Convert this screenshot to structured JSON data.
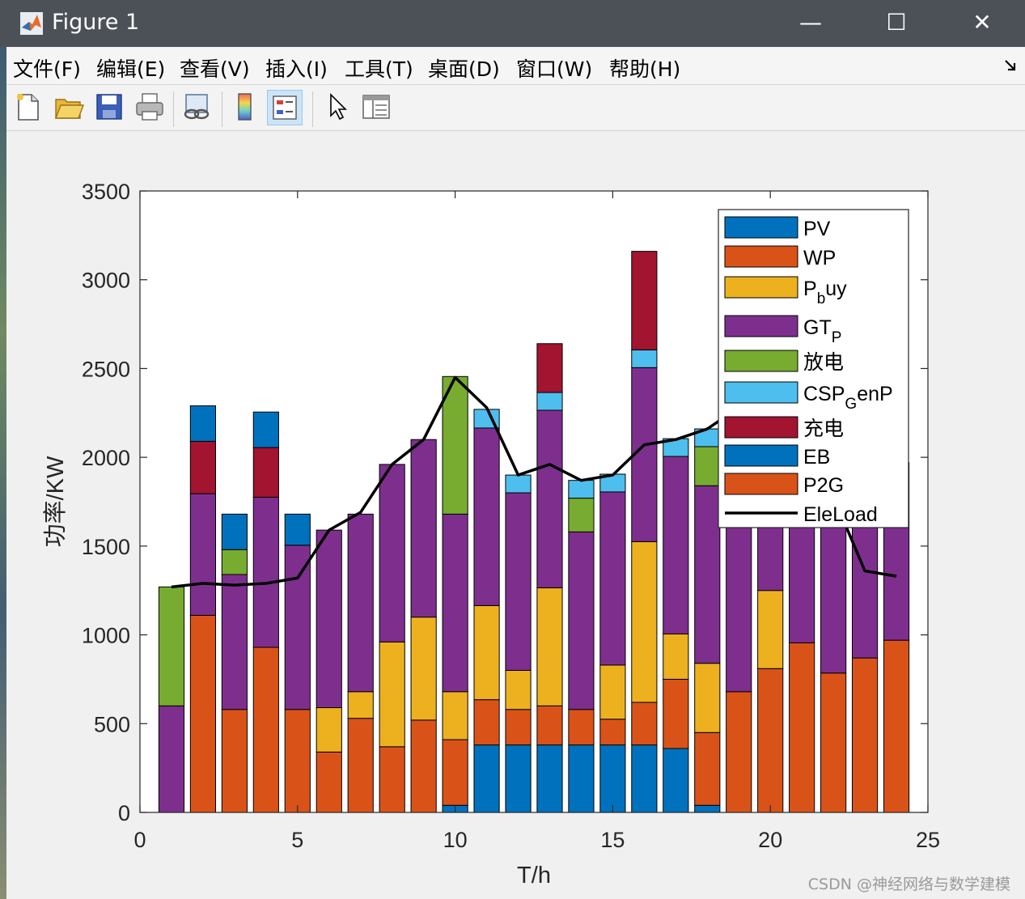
{
  "window": {
    "title": "Figure 1",
    "minimize": "—",
    "maximize": "☐",
    "close": "✕"
  },
  "menu": [
    "文件(F)",
    "编辑(E)",
    "查看(V)",
    "插入(I)",
    "工具(T)",
    "桌面(D)",
    "窗口(W)",
    "帮助(H)"
  ],
  "toolbar": [
    "new-figure",
    "open-file",
    "save",
    "print",
    "link-plot",
    "colorbar",
    "legend",
    "edit-plot",
    "property-inspector"
  ],
  "watermark": "CSDN @神经网络与数学建模",
  "chart_data": {
    "type": "bar",
    "stacked": true,
    "xlabel": "T/h",
    "ylabel": "功率/KW",
    "xlim": [
      0,
      25
    ],
    "ylim": [
      0,
      3500
    ],
    "xticks": [
      0,
      5,
      10,
      15,
      20,
      25
    ],
    "yticks": [
      0,
      500,
      1000,
      1500,
      2000,
      2500,
      3000,
      3500
    ],
    "legend_position": "top-right",
    "x": [
      1,
      2,
      3,
      4,
      5,
      6,
      7,
      8,
      9,
      10,
      11,
      12,
      13,
      14,
      15,
      16,
      17,
      18,
      19,
      20,
      21,
      22,
      23,
      24
    ],
    "series": [
      {
        "name": "PV",
        "sub": "",
        "color": "#0072bd",
        "values": [
          0,
          0,
          0,
          0,
          0,
          0,
          0,
          0,
          0,
          40,
          380,
          380,
          380,
          380,
          380,
          380,
          360,
          40,
          0,
          0,
          0,
          0,
          0,
          0
        ]
      },
      {
        "name": "WP",
        "sub": "",
        "color": "#d95319",
        "values": [
          0,
          1110,
          580,
          930,
          580,
          340,
          530,
          370,
          520,
          370,
          255,
          200,
          220,
          200,
          145,
          240,
          390,
          410,
          680,
          810,
          955,
          785,
          870,
          970
        ]
      },
      {
        "name": "P",
        "sub": "b",
        "suffix": "uy",
        "color": "#edb120",
        "values": [
          0,
          0,
          0,
          0,
          0,
          250,
          150,
          590,
          580,
          270,
          530,
          220,
          665,
          0,
          305,
          905,
          255,
          390,
          0,
          440,
          0,
          0,
          0,
          0
        ]
      },
      {
        "name": "GT",
        "sub": "P",
        "color": "#7e2f8e",
        "values": [
          600,
          685,
          760,
          845,
          925,
          1000,
          1000,
          1000,
          1000,
          1000,
          1000,
          1000,
          1000,
          1000,
          975,
          980,
          1000,
          1000,
          1000,
          1000,
          1000,
          1000,
          1000,
          1000
        ]
      },
      {
        "name": "放电",
        "sub": "",
        "color": "#77ac30",
        "values": [
          670,
          0,
          140,
          0,
          0,
          0,
          0,
          0,
          0,
          775,
          0,
          0,
          0,
          190,
          0,
          0,
          0,
          220,
          0,
          0,
          0,
          0,
          0,
          0
        ]
      },
      {
        "name": "CSP",
        "sub": "G",
        "suffix": "enP",
        "color": "#4dbeee",
        "values": [
          0,
          0,
          0,
          0,
          0,
          0,
          0,
          0,
          0,
          0,
          105,
          100,
          100,
          100,
          100,
          100,
          100,
          100,
          0,
          0,
          0,
          0,
          0,
          0
        ]
      },
      {
        "name": "充电",
        "sub": "",
        "color": "#a2142f",
        "values": [
          0,
          295,
          0,
          280,
          0,
          0,
          0,
          0,
          0,
          0,
          0,
          0,
          275,
          0,
          0,
          555,
          0,
          0,
          0,
          0,
          0,
          0,
          0,
          0
        ]
      },
      {
        "name": "EB",
        "sub": "",
        "color": "#0072bd",
        "values": [
          0,
          200,
          200,
          200,
          175,
          0,
          0,
          0,
          0,
          0,
          0,
          0,
          0,
          0,
          0,
          0,
          0,
          0,
          0,
          0,
          0,
          0,
          0,
          0
        ]
      },
      {
        "name": "P2G",
        "sub": "",
        "color": "#d95319",
        "values": [
          0,
          0,
          0,
          0,
          0,
          0,
          0,
          0,
          0,
          0,
          0,
          0,
          0,
          0,
          0,
          0,
          0,
          0,
          0,
          0,
          0,
          0,
          0,
          0
        ]
      }
    ],
    "line": {
      "name": "EleLoad",
      "color": "#000000",
      "values": [
        1270,
        1290,
        1280,
        1290,
        1320,
        1590,
        1690,
        1960,
        2100,
        2450,
        2280,
        1900,
        1960,
        1870,
        1900,
        2070,
        2100,
        2160,
        2280,
        2000,
        1900,
        1780,
        1360,
        1330
      ]
    }
  }
}
